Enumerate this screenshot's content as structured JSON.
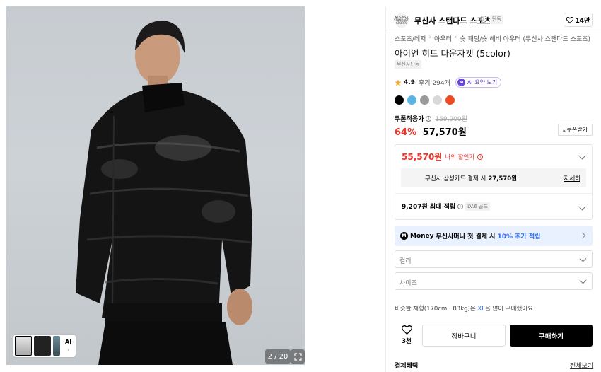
{
  "gallery": {
    "counter": "2 / 20",
    "thumb_ai_label": "AI",
    "expand_icon": "expand-icon"
  },
  "brand": {
    "logo_text": "MUSINSA STANDARD SPORTS",
    "name": "무신사 스탠다드 스포츠",
    "badge": "단독",
    "likes": "14만"
  },
  "breadcrumb": [
    "스포츠/레저",
    "아우터",
    "숏 패딩/숏 헤비 아우터 (무신사 스탠다드 스포츠)"
  ],
  "product": {
    "title": "아이언 히트 다운자켓 (5color)",
    "exclusive_tag": "무신사단독",
    "rating": "4.9",
    "reviews": "후기 294개",
    "ai_summary": "AI 요약 보기",
    "colors": [
      "#000000",
      "#5ab4e3",
      "#9a9a9a",
      "#d8d8d8",
      "#f04a25"
    ]
  },
  "price": {
    "coupon_label": "쿠폰적용가",
    "original": "159,900원",
    "discount": "64%",
    "final": "57,570원",
    "coupon_button": "쿠폰받기"
  },
  "benefits": {
    "my_discount_price": "55,570원",
    "my_discount_label": "나의 할인가",
    "card_text": "무신사 삼성카드 결제 시",
    "card_price": "27,570원",
    "card_more": "자세히",
    "points": "9,207원 최대 적립",
    "level": "LV.6 골드"
  },
  "money": {
    "logo": "M",
    "brand": "Money",
    "text": "무신사머니 첫 결제 시",
    "highlight": "10% 추가 적립"
  },
  "options": {
    "color_placeholder": "컬러",
    "size_placeholder": "사이즈"
  },
  "size_hint": {
    "prefix": "비슷한 체형(170cm · 83kg)은",
    "size": "XL",
    "suffix": "을 많이 구매했어요"
  },
  "actions": {
    "wish_count": "3천",
    "cart": "장바구니",
    "buy": "구매하기"
  },
  "footer": {
    "pay_benefit": "결제혜택",
    "view_all": "전체보기"
  }
}
